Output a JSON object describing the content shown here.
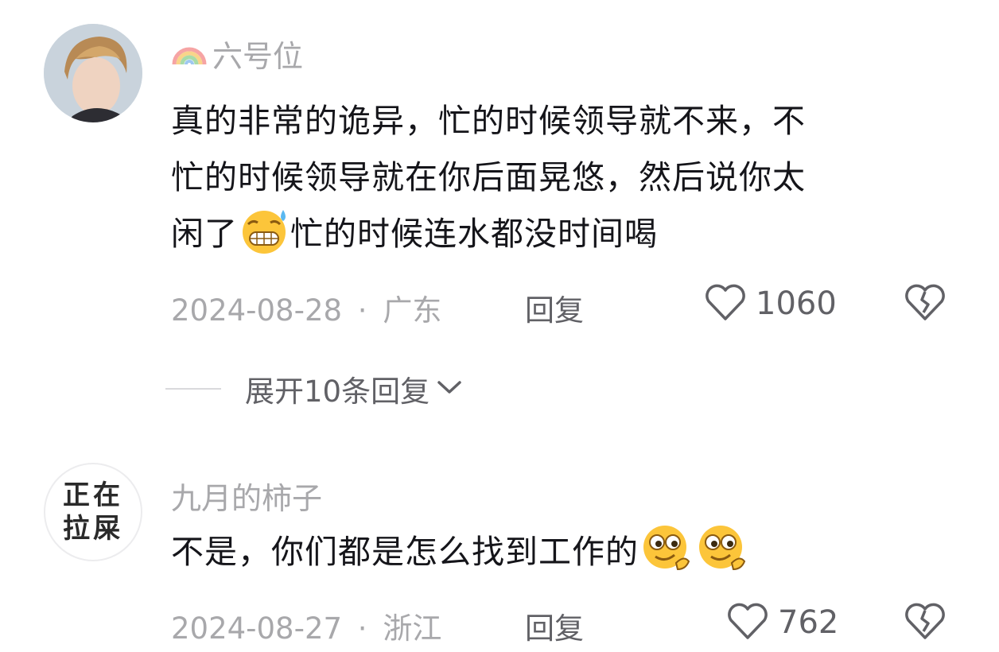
{
  "comments": [
    {
      "username": "六号位",
      "badge_icon": "rainbow-icon",
      "text_lines": [
        "真的非常的诡异，忙的时候领导就不来，不",
        "忙的时候领导就在你后面晃悠，然后说你太",
        "闲了"
      ],
      "text_after_emoji": "忙的时候连水都没时间喝",
      "inline_emoji": "grimace-sweat-emoji",
      "date": "2024-08-28",
      "separator": "·",
      "location": "广东",
      "reply_label": "回复",
      "like_count": "1060",
      "expand_label": "展开10条回复"
    },
    {
      "username": "九月的柿子",
      "avatar_text_line1": "正在",
      "avatar_text_line2": "拉屎",
      "text": "不是，你们都是怎么找到工作的",
      "inline_emojis": [
        "smirk-emoji",
        "smirk-emoji"
      ],
      "date": "2024-08-27",
      "separator": "·",
      "location": "浙江",
      "reply_label": "回复",
      "like_count": "762"
    }
  ],
  "colors": {
    "text": "#15151a",
    "meta": "#a8a8ab",
    "action": "#616166",
    "divider": "#d9d9dc"
  }
}
